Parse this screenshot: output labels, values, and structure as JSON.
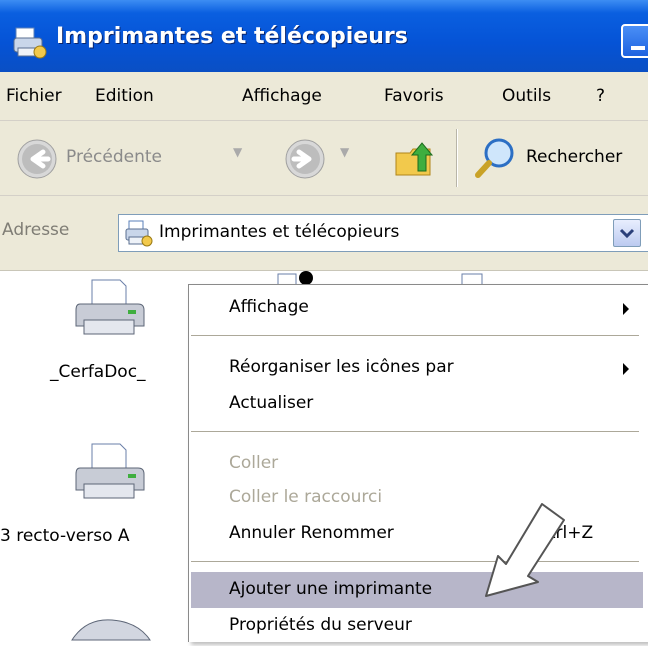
{
  "window": {
    "title": "Imprimantes et télécopieurs",
    "icon": "printers-folder-icon"
  },
  "menubar": {
    "items": [
      "Fichier",
      "Edition",
      "Affichage",
      "Favoris",
      "Outils",
      "?"
    ]
  },
  "toolbar": {
    "back_label": "Précédente",
    "search_label": "Rechercher"
  },
  "address": {
    "label": "Adresse",
    "value": "Imprimantes et télécopieurs"
  },
  "printers": [
    {
      "label": "_CerfaDoc_",
      "icon": "printer-icon"
    },
    {
      "label": "3 recto-verso A",
      "icon": "printer-icon"
    },
    {
      "label": "",
      "icon": "fax-icon"
    }
  ],
  "context_menu": {
    "affichage": "Affichage",
    "reorganiser": "Réorganiser les icônes par",
    "actualiser": "Actualiser",
    "coller": "Coller",
    "coller_raccourci": "Coller le raccourci",
    "annuler": "Annuler Renommer",
    "annuler_shortcut": "Ctrl+Z",
    "ajouter": "Ajouter une imprimante",
    "proprietes": "Propriétés du serveur",
    "highlighted": "Ajouter une imprimante"
  },
  "colors": {
    "titlebar": "#0553d6",
    "menu_bg": "#ece9d8",
    "highlight": "#b7b6c9",
    "disabled_text": "#aca899"
  }
}
